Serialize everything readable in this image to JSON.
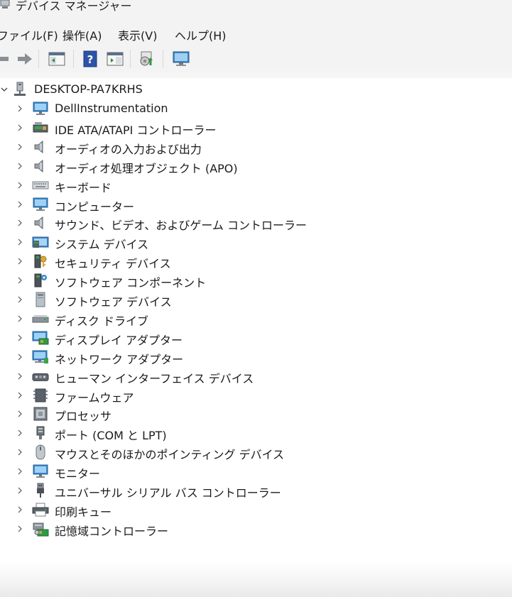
{
  "window": {
    "title": "デバイス マネージャー",
    "icon": "device-manager-icon"
  },
  "menu": {
    "file": "ファイル(F)",
    "action": "操作(A)",
    "view": "表示(V)",
    "help": "ヘルプ(H)"
  },
  "toolbar": {
    "buttons": [
      "back-arrow-icon",
      "forward-arrow-icon",
      "show-hide-console-tree-icon",
      "help-icon",
      "action-pane-icon",
      "scan-hardware-icon",
      "display-monitor-icon"
    ]
  },
  "tree": {
    "root": {
      "label": "DESKTOP-PA7KRHS",
      "icon": "computer-network-icon",
      "expanded": true
    },
    "items": [
      {
        "label": "DellInstrumentation",
        "icon": "monitor-icon"
      },
      {
        "label": "IDE ATA/ATAPI コントローラー",
        "icon": "ide-controller-icon"
      },
      {
        "label": "オーディオの入力および出力",
        "icon": "speaker-icon"
      },
      {
        "label": "オーディオ処理オブジェクト (APO)",
        "icon": "speaker-icon"
      },
      {
        "label": "キーボード",
        "icon": "keyboard-icon"
      },
      {
        "label": "コンピューター",
        "icon": "monitor-icon"
      },
      {
        "label": "サウンド、ビデオ、およびゲーム コントローラー",
        "icon": "speaker-icon"
      },
      {
        "label": "システム デバイス",
        "icon": "system-folder-icon"
      },
      {
        "label": "セキュリティ デバイス",
        "icon": "security-key-icon"
      },
      {
        "label": "ソフトウェア コンポーネント",
        "icon": "software-component-icon"
      },
      {
        "label": "ソフトウェア デバイス",
        "icon": "software-device-icon"
      },
      {
        "label": "ディスク ドライブ",
        "icon": "disk-drive-icon"
      },
      {
        "label": "ディスプレイ アダプター",
        "icon": "display-adapter-icon"
      },
      {
        "label": "ネットワーク アダプター",
        "icon": "network-adapter-icon"
      },
      {
        "label": "ヒューマン インターフェイス デバイス",
        "icon": "hid-icon"
      },
      {
        "label": "ファームウェア",
        "icon": "firmware-chip-icon"
      },
      {
        "label": "プロセッサ",
        "icon": "processor-icon"
      },
      {
        "label": "ポート (COM と LPT)",
        "icon": "port-icon"
      },
      {
        "label": "マウスとそのほかのポインティング デバイス",
        "icon": "mouse-icon"
      },
      {
        "label": "モニター",
        "icon": "monitor-icon"
      },
      {
        "label": "ユニバーサル シリアル バス コントローラー",
        "icon": "usb-icon"
      },
      {
        "label": "印刷キュー",
        "icon": "printer-icon"
      },
      {
        "label": "記憶域コントローラー",
        "icon": "storage-controller-icon"
      }
    ]
  }
}
